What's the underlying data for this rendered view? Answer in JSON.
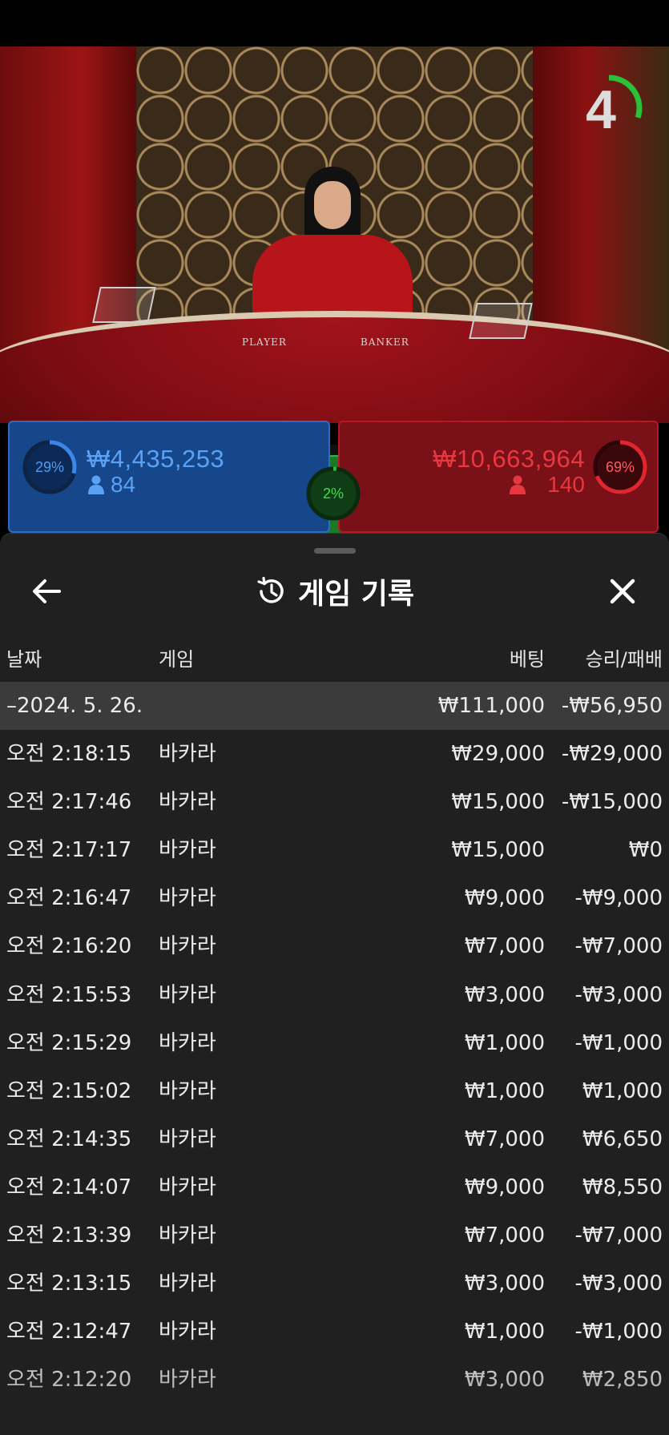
{
  "stream": {
    "table_label_player": "PLAYER",
    "table_label_banker": "BANKER",
    "countdown": "4",
    "countdown_fraction": 0.3
  },
  "bets": {
    "player": {
      "percent": "29%",
      "percent_value": 29,
      "amount": "₩4,435,253",
      "count": "84"
    },
    "tie": {
      "percent": "2%",
      "percent_value": 2
    },
    "banker": {
      "percent": "69%",
      "percent_value": 69,
      "amount": "₩10,663,964",
      "count": "140"
    }
  },
  "colors": {
    "player": "#2f6bc2",
    "banker": "#d12a2a",
    "tie": "#2bbf3a",
    "sheet_bg": "#202020"
  },
  "history": {
    "title": "게임 기록",
    "back_icon": "arrow-left-icon",
    "title_icon": "history-icon",
    "close_icon": "close-icon",
    "headers": {
      "date": "날짜",
      "game": "게임",
      "bet": "베팅",
      "result": "승리/패배"
    },
    "summary": {
      "date": "–2024. 5. 26.",
      "bet": "₩111,000",
      "result": "-₩56,950"
    },
    "rows": [
      {
        "time": "오전 2:18:15",
        "game": "바카라",
        "bet": "₩29,000",
        "result": "-₩29,000"
      },
      {
        "time": "오전 2:17:46",
        "game": "바카라",
        "bet": "₩15,000",
        "result": "-₩15,000"
      },
      {
        "time": "오전 2:17:17",
        "game": "바카라",
        "bet": "₩15,000",
        "result": "₩0"
      },
      {
        "time": "오전 2:16:47",
        "game": "바카라",
        "bet": "₩9,000",
        "result": "-₩9,000"
      },
      {
        "time": "오전 2:16:20",
        "game": "바카라",
        "bet": "₩7,000",
        "result": "-₩7,000"
      },
      {
        "time": "오전 2:15:53",
        "game": "바카라",
        "bet": "₩3,000",
        "result": "-₩3,000"
      },
      {
        "time": "오전 2:15:29",
        "game": "바카라",
        "bet": "₩1,000",
        "result": "-₩1,000"
      },
      {
        "time": "오전 2:15:02",
        "game": "바카라",
        "bet": "₩1,000",
        "result": "₩1,000"
      },
      {
        "time": "오전 2:14:35",
        "game": "바카라",
        "bet": "₩7,000",
        "result": "₩6,650"
      },
      {
        "time": "오전 2:14:07",
        "game": "바카라",
        "bet": "₩9,000",
        "result": "₩8,550"
      },
      {
        "time": "오전 2:13:39",
        "game": "바카라",
        "bet": "₩7,000",
        "result": "-₩7,000"
      },
      {
        "time": "오전 2:13:15",
        "game": "바카라",
        "bet": "₩3,000",
        "result": "-₩3,000"
      },
      {
        "time": "오전 2:12:47",
        "game": "바카라",
        "bet": "₩1,000",
        "result": "-₩1,000"
      },
      {
        "time": "오전 2:12:20",
        "game": "바카라",
        "bet": "₩3,000",
        "result": "₩2,850"
      }
    ]
  }
}
